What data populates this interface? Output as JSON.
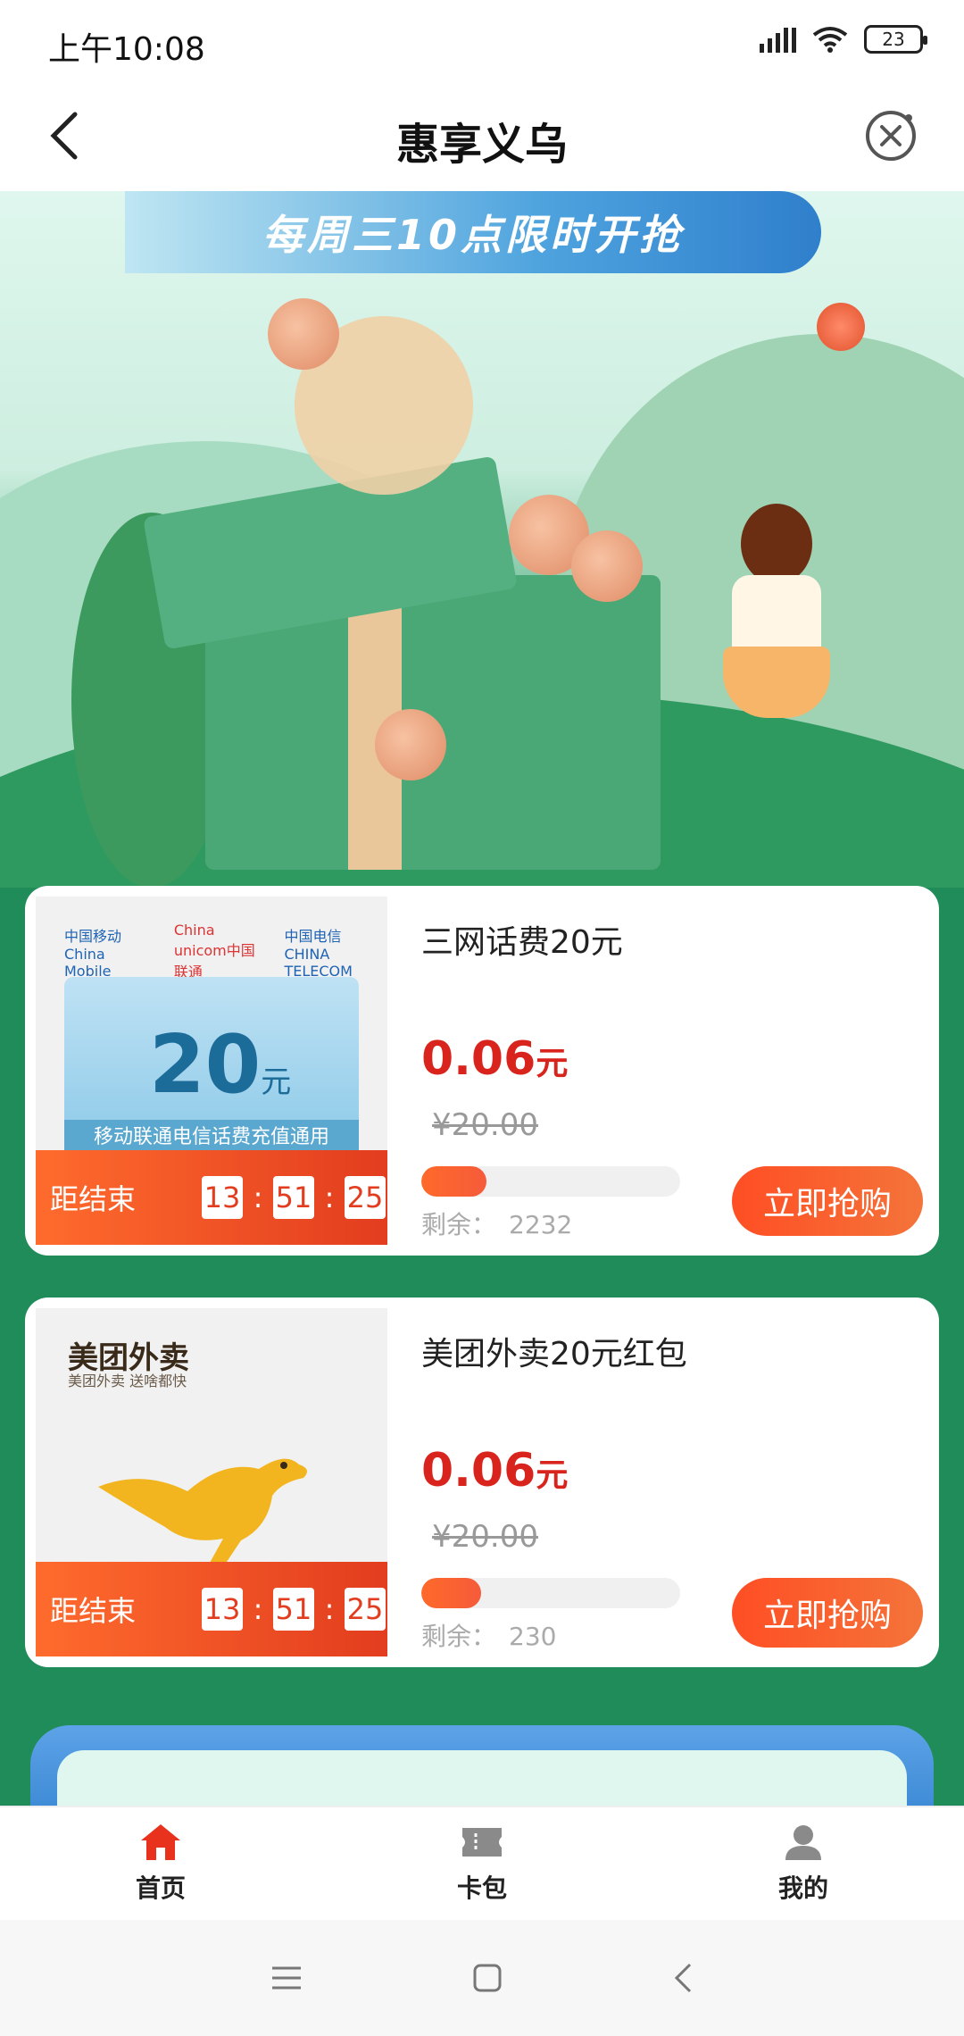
{
  "status_bar": {
    "time": "上午10:08",
    "battery": "23"
  },
  "nav": {
    "title": "惠享义乌"
  },
  "hero": {
    "ribbon_text": "每周三10点限时开抢"
  },
  "products": [
    {
      "name": "三网话费20元",
      "price": "0.06",
      "price_unit": "元",
      "original_price": "¥20.00",
      "progress_fraction": 0.25,
      "remain_label": "剩余：",
      "remain_value": "2232",
      "buy_label": "立即抢购",
      "countdown_label": "距结束",
      "countdown": {
        "h": "13",
        "m": "51",
        "s": "25"
      },
      "image": {
        "brands": [
          "中国移动 China Mobile",
          "China unicom中国联通",
          "中国电信 CHINA TELECOM"
        ],
        "amount": "20",
        "amount_unit": "元",
        "caption": "移动联通电信话费充值通用"
      }
    },
    {
      "name": "美团外卖20元红包",
      "price": "0.06",
      "price_unit": "元",
      "original_price": "¥20.00",
      "progress_fraction": 0.23,
      "remain_label": "剩余：",
      "remain_value": "230",
      "buy_label": "立即抢购",
      "countdown_label": "距结束",
      "countdown": {
        "h": "13",
        "m": "51",
        "s": "25"
      },
      "image": {
        "brand": "美团外卖",
        "slogan": "美团外卖 送啥都快"
      }
    }
  ],
  "tabbar": [
    {
      "label": "首页",
      "icon": "home-icon",
      "active": true,
      "color": "#e8321e"
    },
    {
      "label": "卡包",
      "icon": "card-wallet-icon",
      "active": false,
      "color": "#8a8a8a"
    },
    {
      "label": "我的",
      "icon": "profile-icon",
      "active": false,
      "color": "#8a8a8a"
    }
  ],
  "colors": {
    "accent": "#e23d1f",
    "price": "#d9241d",
    "background_green": "#1f8c5a"
  }
}
